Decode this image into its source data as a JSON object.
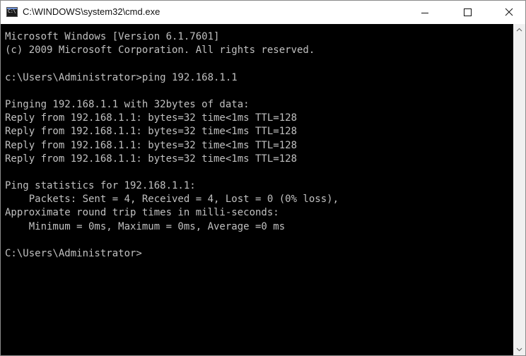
{
  "window": {
    "title": "C:\\WINDOWS\\system32\\cmd.exe",
    "icon": "cmd-icon",
    "icon_text": "C:\\"
  },
  "controls": {
    "minimize_icon": "minimize-icon",
    "maximize_icon": "maximize-icon",
    "close_icon": "close-icon"
  },
  "console": {
    "background": "#000000",
    "foreground": "#c0c0c0",
    "lines": [
      "Microsoft Windows [Version 6.1.7601]",
      "(c) 2009 Microsoft Corporation. All rights reserved.",
      "",
      "c:\\Users\\Administrator>ping 192.168.1.1",
      "",
      "Pinging 192.168.1.1 with 32bytes of data:",
      "Reply from 192.168.1.1: bytes=32 time<1ms TTL=128",
      "Reply from 192.168.1.1: bytes=32 time<1ms TTL=128",
      "Reply from 192.168.1.1: bytes=32 time<1ms TTL=128",
      "Reply from 192.168.1.1: bytes=32 time<1ms TTL=128",
      "",
      "Ping statistics for 192.168.1.1:",
      "    Packets: Sent = 4, Received = 4, Lost = 0 (0% loss),",
      "Approximate round trip times in milli-seconds:",
      "    Minimum = 0ms, Maximum = 0ms, Average =0 ms",
      "",
      "C:\\Users\\Administrator>"
    ]
  },
  "scrollbar": {
    "up_icon": "scroll-up-arrow-icon",
    "down_icon": "scroll-down-arrow-icon"
  }
}
